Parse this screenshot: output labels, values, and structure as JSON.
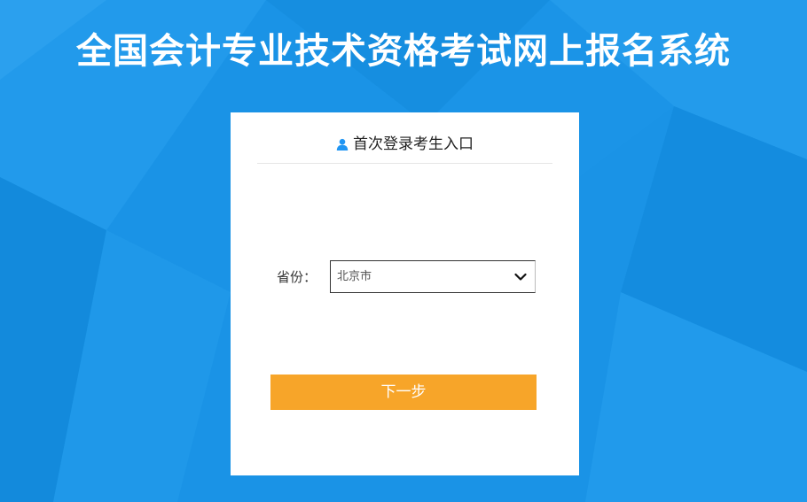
{
  "header": {
    "title": "全国会计专业技术资格考试网上报名系统"
  },
  "login_card": {
    "title": "首次登录考生入口",
    "province_label": "省份：",
    "province_selected": "北京市",
    "next_button_label": "下一步"
  },
  "icons": {
    "user": "user-icon",
    "dropdown": "chevron-down-icon"
  },
  "colors": {
    "background": "#1a93e6",
    "accent": "#2196f3",
    "button": "#f7a529"
  }
}
